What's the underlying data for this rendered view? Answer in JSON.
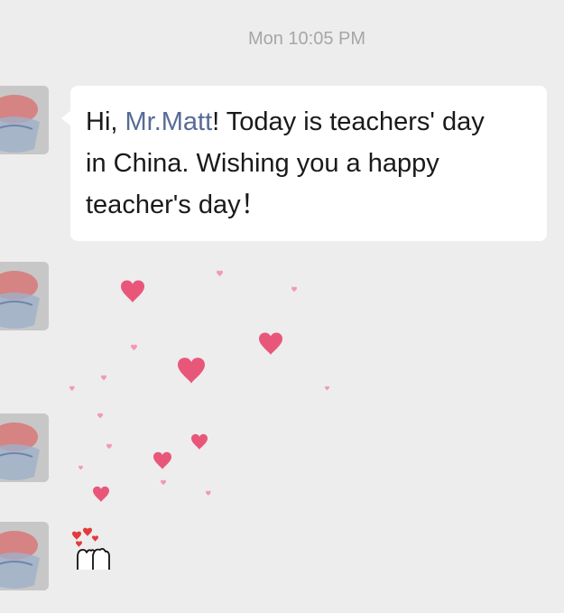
{
  "chat": {
    "timestamp": "Mon 10:05 PM",
    "message": {
      "greeting": "Hi, ",
      "mention": "Mr.Matt",
      "line1_rest": "! Today is teachers' day",
      "line2": "in China. Wishing you a happy",
      "line3": "teacher's day！"
    },
    "stickers": [
      {
        "icon": "floating-hearts-sticker"
      },
      {
        "icon": "hands-with-hearts-sticker"
      }
    ]
  },
  "colors": {
    "background": "#ededed",
    "bubble": "#ffffff",
    "mention": "#576b95",
    "timestamp": "#a6a6a6",
    "heart": "#e8577a"
  }
}
